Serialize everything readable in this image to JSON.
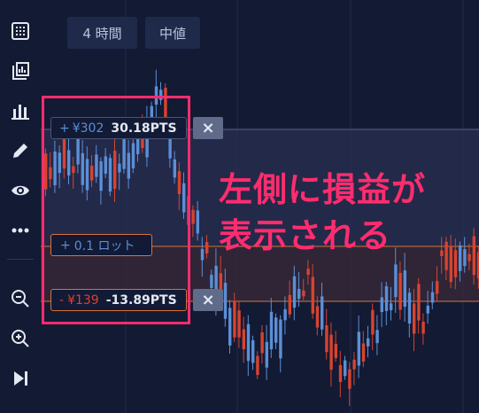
{
  "toolbar": {
    "items": [
      {
        "icon": "calculator-icon"
      },
      {
        "icon": "chart-pages-icon"
      },
      {
        "icon": "bar-chart-icon"
      },
      {
        "icon": "pencil-icon"
      },
      {
        "icon": "eye-icon"
      },
      {
        "icon": "more-icon"
      },
      {
        "icon": "zoom-out-icon"
      },
      {
        "icon": "zoom-in-icon"
      },
      {
        "icon": "skip-to-end-icon"
      }
    ]
  },
  "chart": {
    "timeframe_label": "4 時間",
    "price_type_label": "中値"
  },
  "positions": {
    "take_profit": {
      "sign": "+",
      "amount": "¥302",
      "pts": "30.18PTS",
      "close": "×"
    },
    "lot": {
      "sign": "+",
      "amount": "0.1 ロット"
    },
    "stop_loss": {
      "sign": "-",
      "amount": "¥139",
      "pts": "-13.89PTS",
      "close": "×"
    }
  },
  "annotation": {
    "line1": "左側に損益が",
    "line2": "表示される"
  },
  "colors": {
    "background": "#131a33",
    "up": "#5b8fd6",
    "down": "#d84330",
    "highlight": "#ff2d6e"
  }
}
